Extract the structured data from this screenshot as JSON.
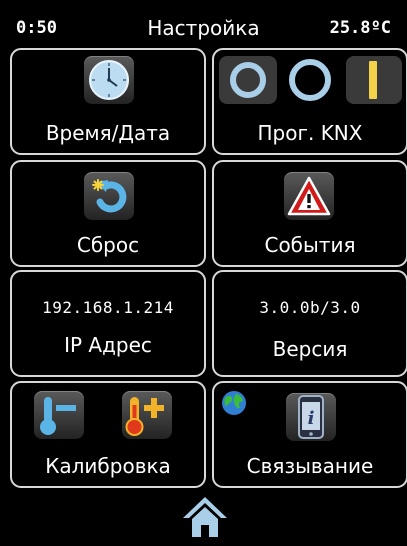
{
  "header": {
    "time": "0:50",
    "title": "Настройка",
    "temperature": "25.8ºC"
  },
  "tiles": {
    "time_date": {
      "label": "Время/Дата"
    },
    "knx_prog": {
      "label": "Прог. KNX"
    },
    "reset": {
      "label": "Сброс"
    },
    "events": {
      "label": "События"
    },
    "ip": {
      "value": "192.168.1.214",
      "label": "IP Адрес"
    },
    "version": {
      "value": "3.0.0b/3.0",
      "label": "Версия"
    },
    "calibration": {
      "label": "Калибровка"
    },
    "linking": {
      "label": "Связывание"
    }
  },
  "icons": {
    "clock": "clock-icon",
    "knx": "knx-programming-icon",
    "reset": "reset-icon",
    "warning": "warning-icon",
    "thermometer_minus": "thermometer-minus-icon",
    "thermometer_plus": "thermometer-plus-icon",
    "globe": "globe-icon",
    "phone_info": "phone-info-icon",
    "home": "home-icon"
  },
  "colors": {
    "accent_blue": "#a9cfe8",
    "warning_red": "#d11a1a",
    "knx_yellow": "#f3d24a"
  }
}
